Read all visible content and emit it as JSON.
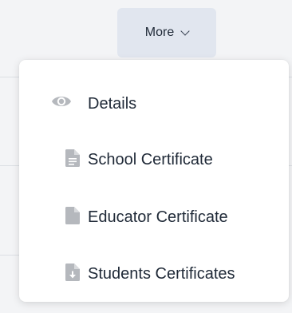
{
  "button": {
    "label": "More",
    "icon": "chevron-down-icon"
  },
  "menu": {
    "items": [
      {
        "label": "Details",
        "icon": "eye-icon"
      },
      {
        "label": "School Certificate",
        "icon": "document-icon"
      },
      {
        "label": "Educator Certificate",
        "icon": "file-icon"
      },
      {
        "label": "Students Certificates",
        "icon": "file-download-icon"
      }
    ]
  },
  "colors": {
    "button_bg": "#e1e6ef",
    "menu_bg": "#ffffff",
    "icon": "#b5b8bd",
    "text": "#1f2937"
  }
}
